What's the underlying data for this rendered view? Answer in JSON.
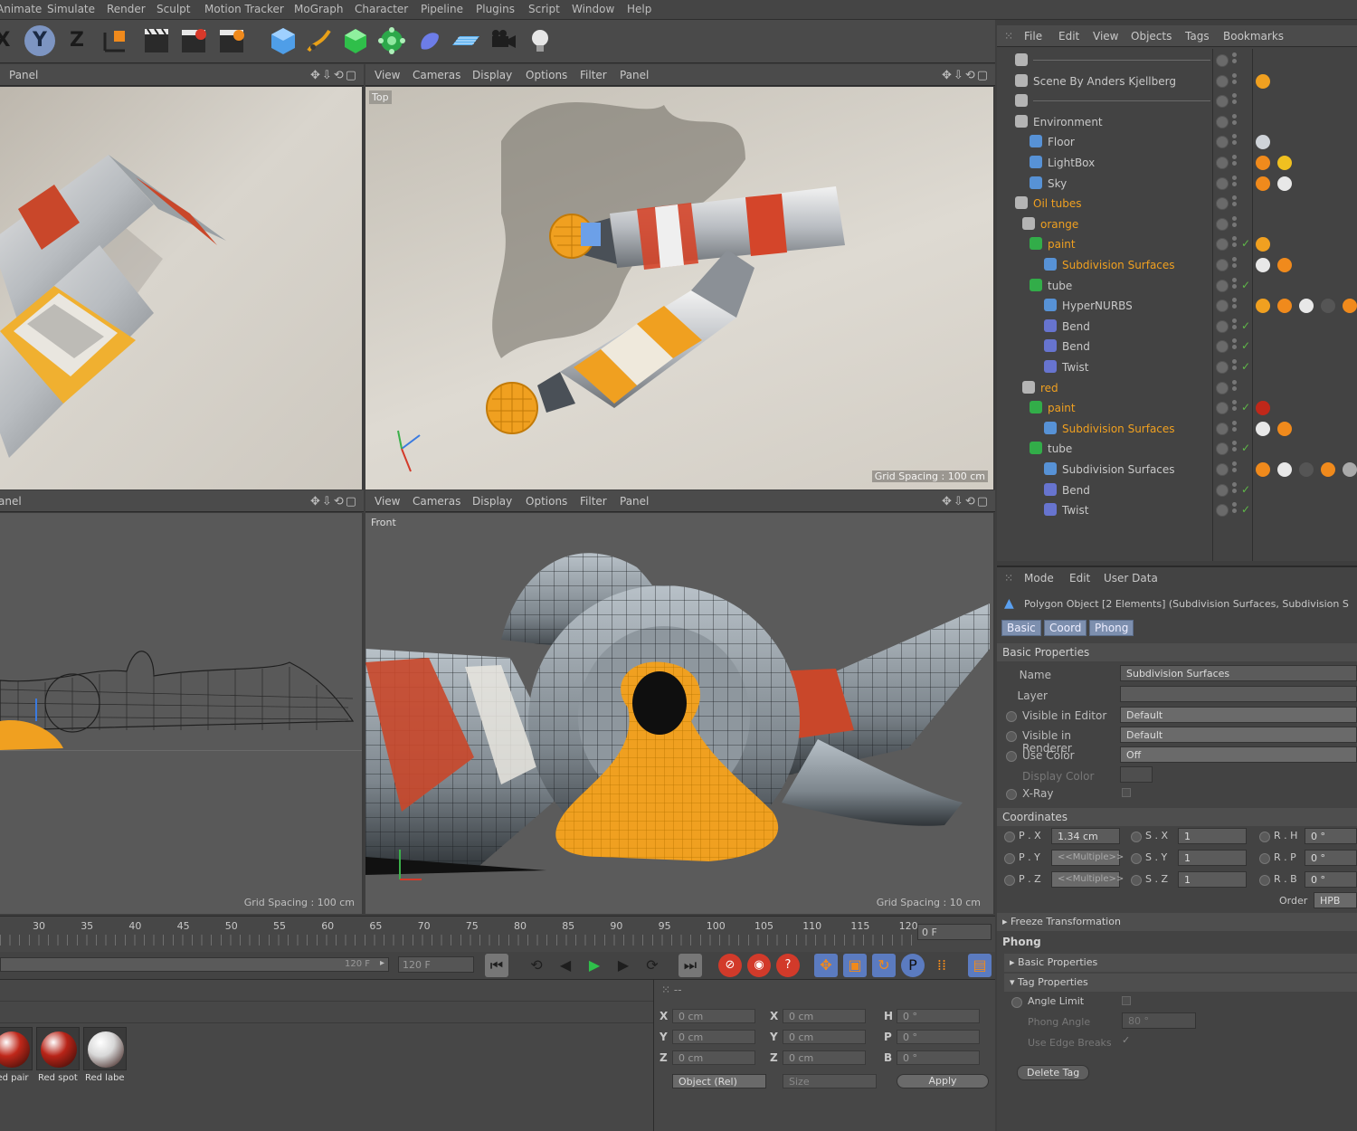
{
  "menu": [
    "Animate",
    "Simulate",
    "Render",
    "Sculpt",
    "Motion Tracker",
    "MoGraph",
    "Character",
    "Pipeline",
    "Plugins",
    "Script",
    "Window",
    "Help"
  ],
  "toolbar": {
    "x_label": "X",
    "y_label": "Y",
    "z_label": "Z"
  },
  "viewports": {
    "menu": [
      "View",
      "Cameras",
      "Display",
      "Options",
      "Filter",
      "Panel"
    ],
    "left_top_menu": "Panel",
    "left_bottom_menu": "anel",
    "top_label": "Top",
    "front_label": "Front",
    "grid_top": "Grid Spacing : 100 cm",
    "grid_left_bottom": "Grid Spacing : 100 cm",
    "grid_front": "Grid Spacing : 10 cm"
  },
  "object_manager": {
    "menu": [
      "File",
      "Edit",
      "View",
      "Objects",
      "Tags",
      "Bookmarks"
    ],
    "rows": [
      {
        "label": "",
        "color": "#c8c8c8"
      },
      {
        "label": "Scene By Anders Kjellberg",
        "color": "#c8c8c8"
      },
      {
        "label": "",
        "color": "#c8c8c8"
      },
      {
        "label": "Environment",
        "color": "#c8c8c8"
      },
      {
        "label": "Floor",
        "color": "#c8c8c8"
      },
      {
        "label": "LightBox",
        "color": "#c8c8c8"
      },
      {
        "label": "Sky",
        "color": "#c8c8c8"
      },
      {
        "label": "Oil tubes",
        "color": "#f0a020"
      },
      {
        "label": "orange",
        "color": "#f0a020"
      },
      {
        "label": "paint",
        "color": "#f0a020"
      },
      {
        "label": "Subdivision Surfaces",
        "color": "#f0a020"
      },
      {
        "label": "tube",
        "color": "#c8c8c8"
      },
      {
        "label": "HyperNURBS",
        "color": "#c8c8c8"
      },
      {
        "label": "Bend",
        "color": "#c8c8c8"
      },
      {
        "label": "Bend",
        "color": "#c8c8c8"
      },
      {
        "label": "Twist",
        "color": "#c8c8c8"
      },
      {
        "label": "red",
        "color": "#f0a020"
      },
      {
        "label": "paint",
        "color": "#f0a020"
      },
      {
        "label": "Subdivision Surfaces",
        "color": "#f0a020"
      },
      {
        "label": "tube",
        "color": "#c8c8c8"
      },
      {
        "label": "Subdivision Surfaces",
        "color": "#c8c8c8"
      },
      {
        "label": "Bend",
        "color": "#c8c8c8"
      },
      {
        "label": "Twist",
        "color": "#c8c8c8"
      }
    ]
  },
  "attributes": {
    "menu": [
      "Mode",
      "Edit",
      "User Data"
    ],
    "object_title": "Polygon Object [2 Elements] (Subdivision Surfaces, Subdivision S",
    "tabs": [
      "Basic",
      "Coord",
      "Phong"
    ],
    "basic_props": "Basic Properties",
    "name_label": "Name",
    "name_value": "Subdivision Surfaces",
    "layer_label": "Layer",
    "vis_editor_label": "Visible in Editor",
    "vis_editor_value": "Default",
    "vis_render_label": "Visible in Renderer",
    "vis_render_value": "Default",
    "use_color_label": "Use Color",
    "use_color_value": "Off",
    "display_color_label": "Display Color",
    "xray_label": "X-Ray",
    "coordinates": "Coordinates",
    "px_label": "P . X",
    "px_value": "1.34 cm",
    "py_label": "P . Y",
    "py_value": "<<Multiple>>",
    "pz_label": "P . Z",
    "pz_value": "<<Multiple>>",
    "sx_label": "S . X",
    "sx_value": "1",
    "sy_label": "S . Y",
    "sy_value": "1",
    "sz_label": "S . Z",
    "sz_value": "1",
    "rh_label": "R . H",
    "rh_value": "0 °",
    "rp_label": "R . P",
    "rp_value": "0 °",
    "rb_label": "R . B",
    "rb_value": "0 °",
    "order_label": "Order",
    "order_value": "HPB",
    "freeze": "Freeze Transformation",
    "phong": "Phong",
    "phong_basic": "Basic Properties",
    "tag_props": "Tag Properties",
    "angle_limit": "Angle Limit",
    "phong_angle": "Phong Angle",
    "phong_angle_value": "80 °",
    "edge_breaks": "Use Edge Breaks",
    "delete_tag": "Delete Tag"
  },
  "timeline": {
    "ticks": [
      "30",
      "35",
      "40",
      "45",
      "50",
      "55",
      "60",
      "65",
      "70",
      "75",
      "80",
      "85",
      "90",
      "95",
      "100",
      "105",
      "110",
      "115",
      "120"
    ],
    "current_frame": "0 F",
    "end_frame_a": "120 F",
    "end_frame_b": "120 F"
  },
  "materials": [
    {
      "name": "Red pair",
      "color": "#c0281a"
    },
    {
      "name": "Red spot",
      "color": "#b82418"
    },
    {
      "name": "Red labe",
      "color": "#d8d8d8"
    }
  ],
  "coords_panel": {
    "x": "X",
    "y": "Y",
    "z": "Z",
    "h": "H",
    "p": "P",
    "b": "B",
    "pos_x": "0 cm",
    "pos_y": "0 cm",
    "pos_z": "0 cm",
    "size_x": "0 cm",
    "size_y": "0 cm",
    "size_z": "0 cm",
    "rot_h": "0 °",
    "rot_p": "0 °",
    "rot_b": "0 °",
    "mode": "Object (Rel)",
    "size_mode": "Size",
    "apply": "Apply"
  }
}
